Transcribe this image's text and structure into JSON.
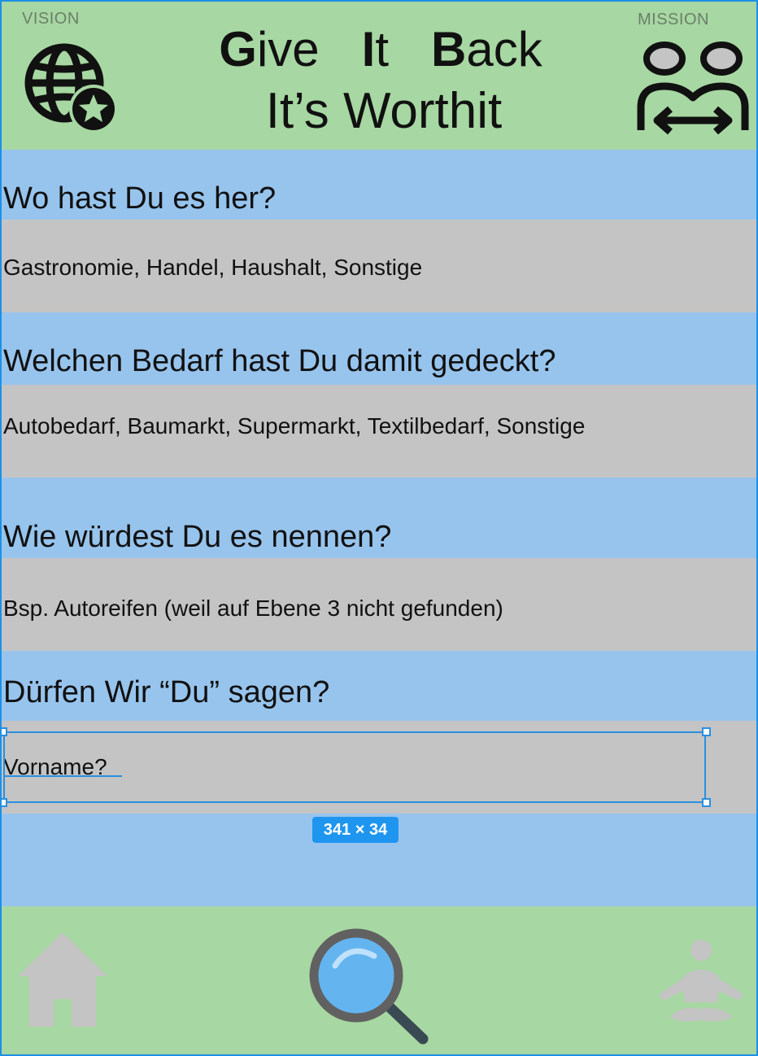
{
  "header": {
    "vision_label": "VISION",
    "mission_label": "MISSION",
    "title_line1": [
      {
        "initial": "G",
        "rest": "ive"
      },
      {
        "initial": "I",
        "rest": "t"
      },
      {
        "initial": "B",
        "rest": "ack"
      }
    ],
    "title_line2": "It’s Worthit",
    "vision_icon": "globe-star-icon",
    "mission_icon": "people-exchange-icon"
  },
  "questions": [
    {
      "question": "Wo hast Du es her?",
      "answer": "Gastronomie, Handel, Haushalt, Sonstige"
    },
    {
      "question": "Welchen Bedarf hast Du damit gedeckt?",
      "answer": "Autobedarf, Baumarkt, Supermarkt, Textilbedarf, Sonstige"
    },
    {
      "question": "Wie würdest Du es nennen?",
      "answer": "Bsp. Autoreifen (weil auf Ebene 3 nicht gefunden)"
    },
    {
      "question": "Dürfen Wir “Du” sagen?",
      "answer": "Vorname?"
    }
  ],
  "selection": {
    "size_label": "341 × 34"
  },
  "footer": {
    "icons": [
      "home-icon",
      "search-icon",
      "yoga-icon"
    ]
  },
  "colors": {
    "header_green": "#a7d7a2",
    "question_blue": "#97c4ed",
    "answer_grey": "#c4c4c4",
    "selection_blue": "#2a8fe0"
  }
}
